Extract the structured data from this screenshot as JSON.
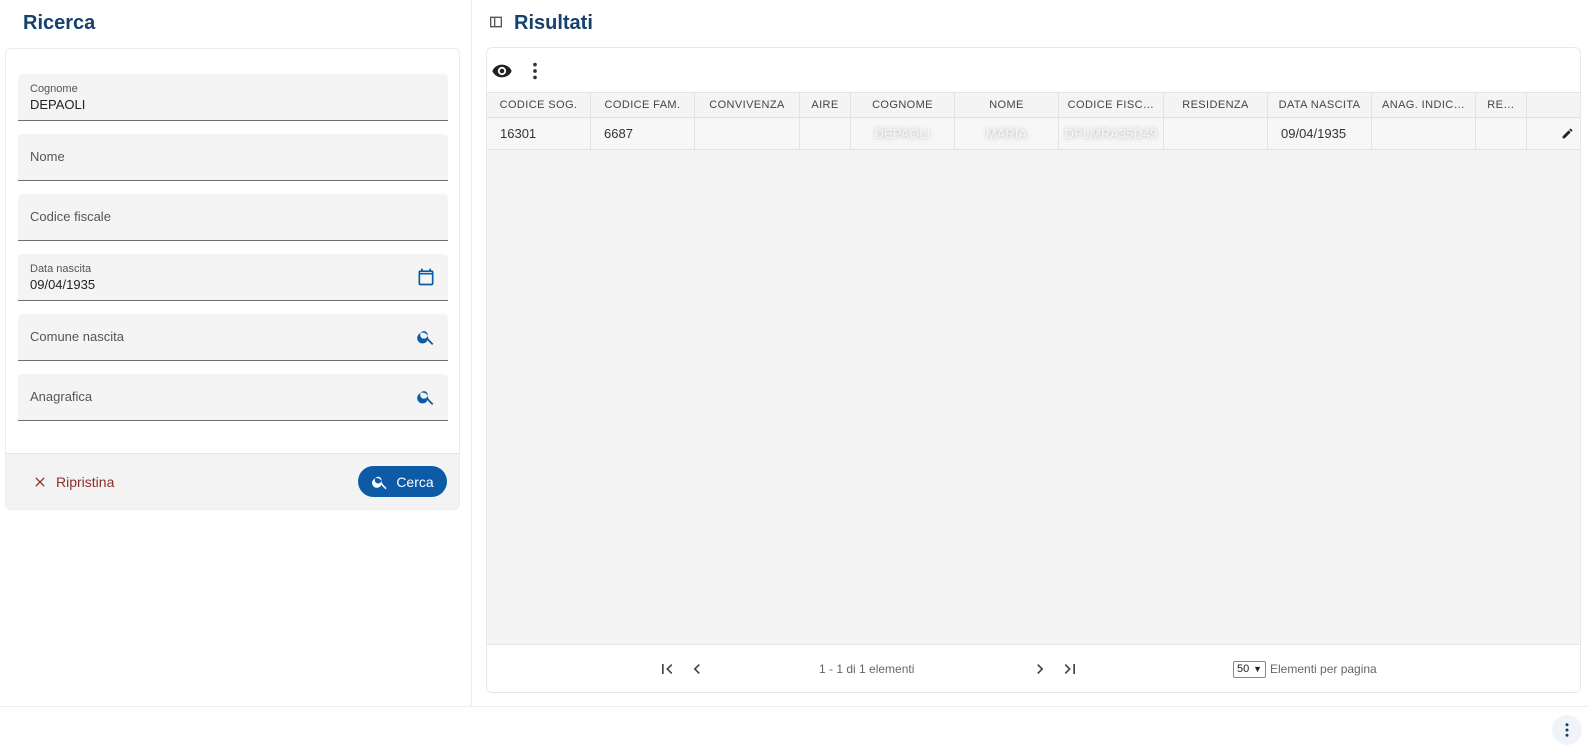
{
  "search": {
    "title": "Ricerca",
    "fields": {
      "cognome": {
        "label": "Cognome",
        "value": "DEPAOLI"
      },
      "nome": {
        "label": "Nome",
        "value": ""
      },
      "codice_fiscale": {
        "label": "Codice fiscale",
        "value": ""
      },
      "data_nascita": {
        "label": "Data nascita",
        "value": "09/04/1935"
      },
      "comune_nascita": {
        "label": "Comune nascita",
        "value": ""
      },
      "anagrafica": {
        "label": "Anagrafica",
        "value": ""
      }
    },
    "reset_label": "Ripristina",
    "search_label": "Cerca"
  },
  "results": {
    "title": "Risultati",
    "columns": [
      "CODICE SOG.",
      "CODICE FAM.",
      "CONVIVENZA",
      "AIRE",
      "COGNOME",
      "NOME",
      "CODICE FISC…",
      "RESIDENZA",
      "DATA NASCITA",
      "ANAG. INDIC…",
      "RE…"
    ],
    "rows": [
      {
        "codice_sog": "16301",
        "codice_fam": "6687",
        "convivenza": "",
        "aire": "",
        "cognome": "DEPAOLI",
        "nome": "MARIA",
        "codice_fisc": "DPLMRA35D49",
        "residenza": "",
        "data_nascita": "09/04/1935",
        "anag_indic": "",
        "re": ""
      }
    ],
    "pagination": {
      "summary": "1 - 1 di 1 elementi",
      "page_size": "50",
      "page_size_label": "Elementi per pagina"
    }
  },
  "colors": {
    "accent": "#0d5aa7",
    "title": "#16406e",
    "reset": "#8b2e2e"
  }
}
